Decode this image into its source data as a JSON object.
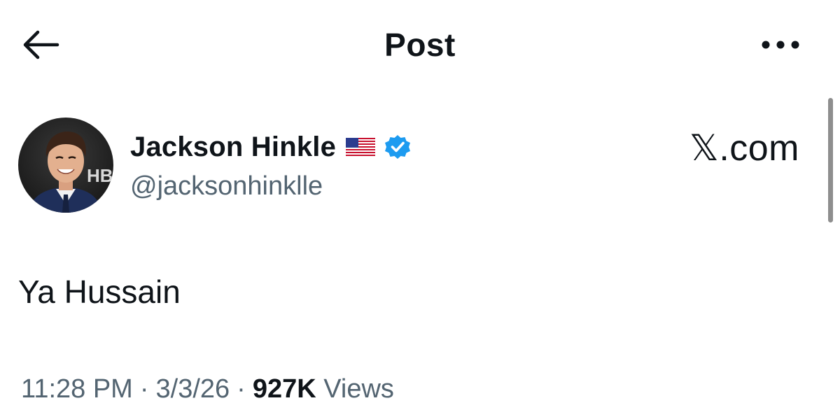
{
  "header": {
    "title": "Post",
    "back_icon": "arrow-left-icon",
    "more_icon": "more-horizontal-icon"
  },
  "author": {
    "display_name": "Jackson Hinkle",
    "flag_icon": "us-flag-icon",
    "verified_icon": "verified-badge-icon",
    "handle": "@jacksonhinklle",
    "avatar_icon": "avatar-photo"
  },
  "watermark": {
    "x_letter": "𝕏",
    "domain": ".com"
  },
  "post": {
    "text": "Ya Hussain"
  },
  "meta": {
    "time": "11:28 PM",
    "separator": "·",
    "date": "3/3/26",
    "views_count": "927K",
    "views_label": "Views"
  },
  "colors": {
    "text_primary": "#0f1419",
    "text_secondary": "#536471",
    "verified_blue": "#1d9bf0",
    "scrollbar": "#8e8e8e"
  }
}
